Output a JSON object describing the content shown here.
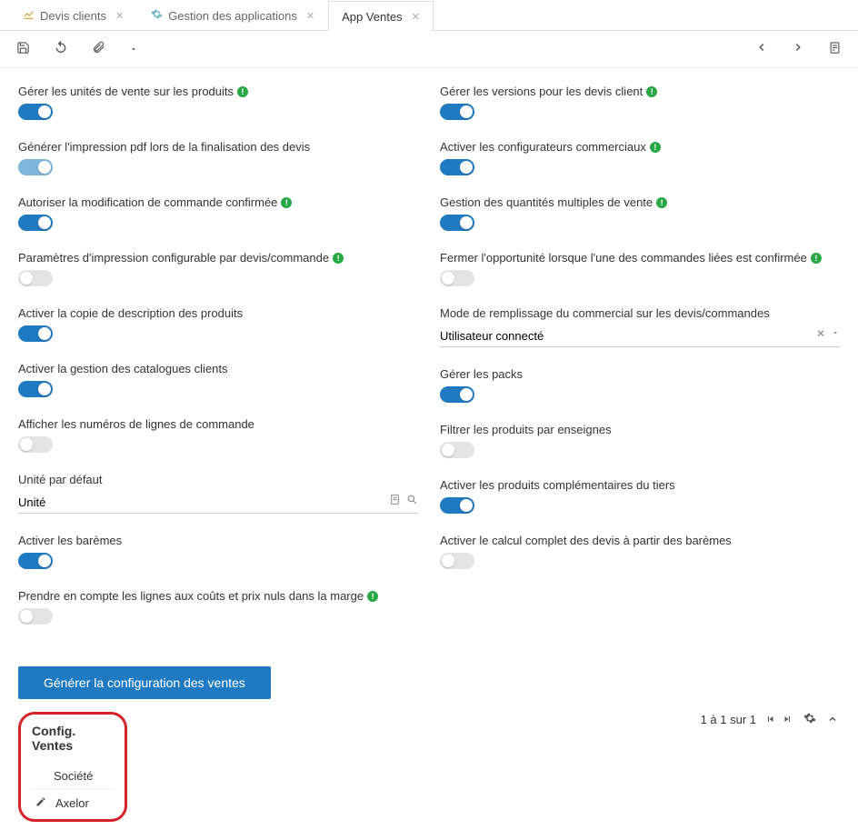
{
  "tabs": [
    {
      "label": "Devis clients"
    },
    {
      "label": "Gestion des applications"
    },
    {
      "label": "App Ventes"
    }
  ],
  "left": [
    {
      "label": "Gérer les unités de vente sur les produits",
      "info": true,
      "toggle": "on"
    },
    {
      "label": "Générer l'impression pdf lors de la finalisation des devis",
      "info": false,
      "toggle": "on-disabled"
    },
    {
      "label": "Autoriser la modification de commande confirmée",
      "info": true,
      "toggle": "on"
    },
    {
      "label": "Paramètres d'impression configurable par devis/commande",
      "info": true,
      "toggle": "off"
    },
    {
      "label": "Activer la copie de description des produits",
      "info": false,
      "toggle": "on"
    },
    {
      "label": "Activer la gestion des catalogues clients",
      "info": false,
      "toggle": "on"
    },
    {
      "label": "Afficher les numéros de lignes de commande",
      "info": false,
      "toggle": "off"
    },
    {
      "label": "Unité par défaut",
      "info": false,
      "input": "Unité"
    },
    {
      "label": "Activer les barèmes",
      "info": false,
      "toggle": "on"
    },
    {
      "label": "Prendre en compte les lignes aux coûts et prix nuls dans la marge",
      "info": true,
      "toggle": "off"
    }
  ],
  "right": [
    {
      "label": "Gérer les versions pour les devis client",
      "info": true,
      "toggle": "on"
    },
    {
      "label": "Activer les configurateurs commerciaux",
      "info": true,
      "toggle": "on"
    },
    {
      "label": "Gestion des quantités multiples de vente",
      "info": true,
      "toggle": "on"
    },
    {
      "label": "Fermer l'opportunité lorsque l'une des commandes liées est confirmée",
      "info": true,
      "toggle": "off"
    },
    {
      "label": "Mode de remplissage du commercial sur les devis/commandes",
      "info": false,
      "select": "Utilisateur connecté"
    },
    {
      "label": "Gérer les packs",
      "info": false,
      "toggle": "on"
    },
    {
      "label": "Filtrer les produits par enseignes",
      "info": false,
      "toggle": "off"
    },
    {
      "label": "Activer les produits complémentaires du tiers",
      "info": false,
      "toggle": "on"
    },
    {
      "label": "Activer le calcul complet des devis à partir des barèmes",
      "info": false,
      "toggle": "off"
    }
  ],
  "button": "Générer la configuration des ventes",
  "config": {
    "title": "Config. Ventes",
    "header": "Société",
    "row": "Axelor"
  },
  "pager": "1 à 1 sur 1"
}
